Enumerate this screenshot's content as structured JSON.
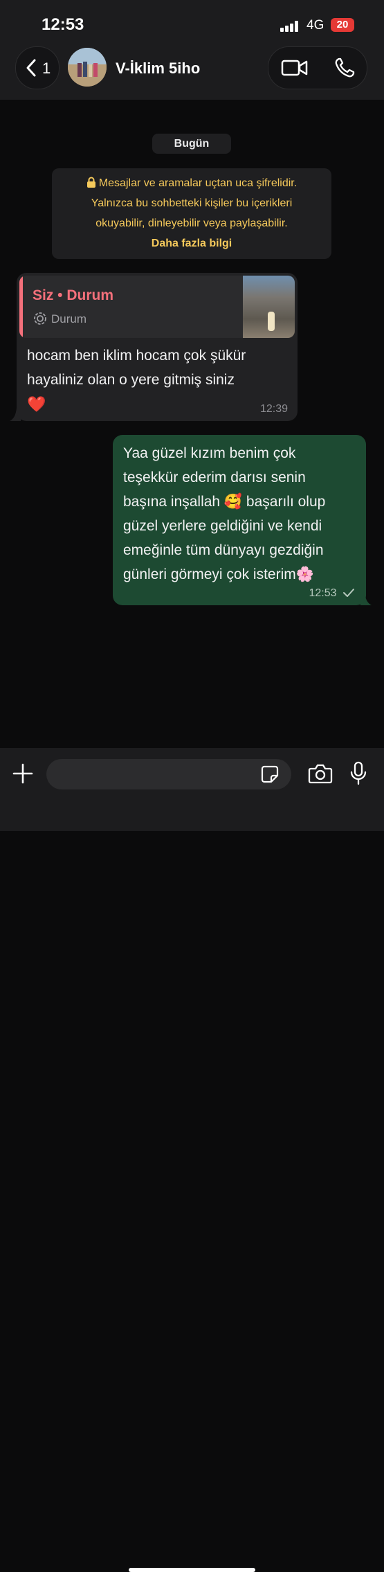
{
  "status_bar": {
    "time": "12:53",
    "network": "4G",
    "battery": "20"
  },
  "header": {
    "back_count": "1",
    "contact_name": "V-İklim 5iho",
    "icons": [
      "chevron-left-icon",
      "video-call-icon",
      "phone-icon"
    ]
  },
  "chat": {
    "date_chip": "Bugün",
    "encryption_notice": {
      "lines": [
        "Mesajlar ve aramalar uçtan uca şifrelidir.",
        "Yalnızca bu sohbetteki kişiler bu içerikleri",
        "okuyabilir, dinleyebilir veya paylaşabilir."
      ],
      "more_link": "Daha fazla bilgi"
    },
    "incoming": {
      "quote_title": "Siz • Durum",
      "quote_sub": "Durum",
      "lines": [
        "hocam ben iklim hocam  çok şükür",
        "hayaliniz olan o yere gitmiş siniz"
      ],
      "emoji": "❤️",
      "time": "12:39"
    },
    "outgoing": {
      "lines": [
        "Yaa güzel kızım benim çok",
        "teşekkür ederim darısı senin",
        "başına inşallah 🥰 başarılı olup",
        "güzel yerlere geldiğini ve kendi",
        "emeğinle tüm dünyayı gezdiğin",
        "günleri görmeyi çok isterim🌸"
      ],
      "time": "12:53"
    }
  },
  "input_bar": {
    "placeholder": "",
    "icons": [
      "plus-icon",
      "sticker-icon",
      "camera-icon",
      "microphone-icon"
    ]
  },
  "colors": {
    "incoming_bubble": "#222224",
    "outgoing_bubble": "#1d4a32",
    "notice_text": "#f5c95b",
    "quote_accent": "#f4707b"
  }
}
